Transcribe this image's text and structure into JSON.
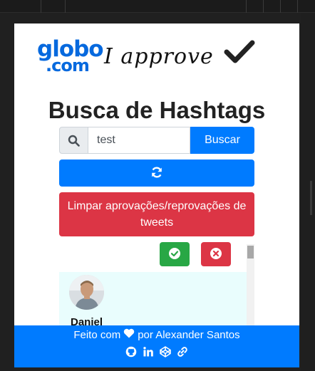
{
  "logo": {
    "globo": "globo",
    "com": ".com",
    "approve": "I approve"
  },
  "title": "Busca de Hashtags",
  "search": {
    "value": "test",
    "button_label": "Buscar"
  },
  "refresh_icon": "refresh-icon",
  "clear_button_label": "Limpar aprovações/reprovações de tweets",
  "tweet": {
    "author": "Daniel"
  },
  "footer": {
    "made_with": "Feito com",
    "by": "por Alexander Santos",
    "icons": [
      "github-icon",
      "linkedin-icon",
      "codepen-icon",
      "link-icon"
    ]
  },
  "colors": {
    "primary": "#007bff",
    "danger": "#dc3545",
    "success": "#28a745",
    "brand_blue": "#0669de",
    "tweet_bg": "#e9fdfd"
  }
}
